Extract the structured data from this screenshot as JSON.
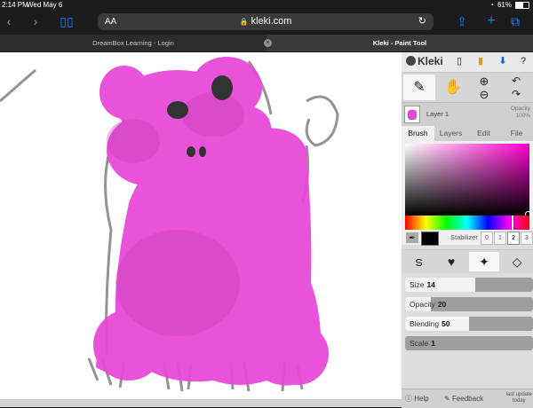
{
  "status_bar": {
    "time": "2:14 PM",
    "date": "Wed May 6",
    "battery": "61%"
  },
  "browser": {
    "url": "kleki.com",
    "aa_label": "AA",
    "tabs": [
      {
        "title": "DreamBox Learning - Login"
      },
      {
        "title": "Kleki - Paint Tool"
      }
    ]
  },
  "app": {
    "name": "Kleki",
    "layer": {
      "name": "Layer 1",
      "opacity_label": "Opacity",
      "opacity_value": "100%"
    },
    "panel_tabs": [
      "Brush",
      "Layers",
      "Edit",
      "File"
    ],
    "stabilizer": {
      "label": "Stabilizer",
      "options": [
        "0",
        "1",
        "2",
        "3"
      ],
      "selected": "2"
    },
    "sliders": [
      {
        "label": "Size",
        "value": "14",
        "fill": 0.55
      },
      {
        "label": "Opacity",
        "value": "20",
        "fill": 0.2
      },
      {
        "label": "Blending",
        "value": "50",
        "fill": 0.5
      },
      {
        "label": "Scale",
        "value": "1",
        "fill": 0.0
      }
    ],
    "footer": {
      "help": "Help",
      "feedback": "Feedback",
      "last_update": "last update",
      "today": "today"
    }
  },
  "colors": {
    "brush": "#e84ad8",
    "primary_swatch": "#000000"
  },
  "icons": [
    "back-icon",
    "forward-icon",
    "book-icon",
    "lock-icon",
    "reload-icon",
    "share-icon",
    "plus-icon",
    "tabs-icon",
    "brush-icon",
    "hand-icon",
    "zoom-in-icon",
    "zoom-out-icon",
    "undo-icon",
    "redo-icon",
    "eyedropper-icon"
  ]
}
